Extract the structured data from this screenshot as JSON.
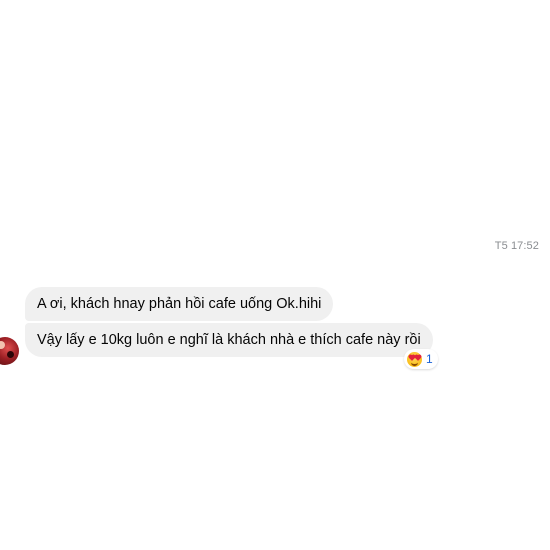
{
  "conversation": {
    "timestamp": "T5 17:52",
    "messages": [
      {
        "text": "A ơi, khách hnay phản hồi cafe uống Ok.hihi"
      },
      {
        "text": "Vậy lấy e 10kg luôn e nghĩ là khách nhà e thích cafe này rồi"
      }
    ],
    "reaction": {
      "emoji": "heart-eyes-emoji-icon",
      "count": "1"
    }
  },
  "colors": {
    "bubble_bg": "#f0f0f0",
    "timestamp_text": "#8a8d91",
    "reaction_count": "#1a62d6"
  }
}
